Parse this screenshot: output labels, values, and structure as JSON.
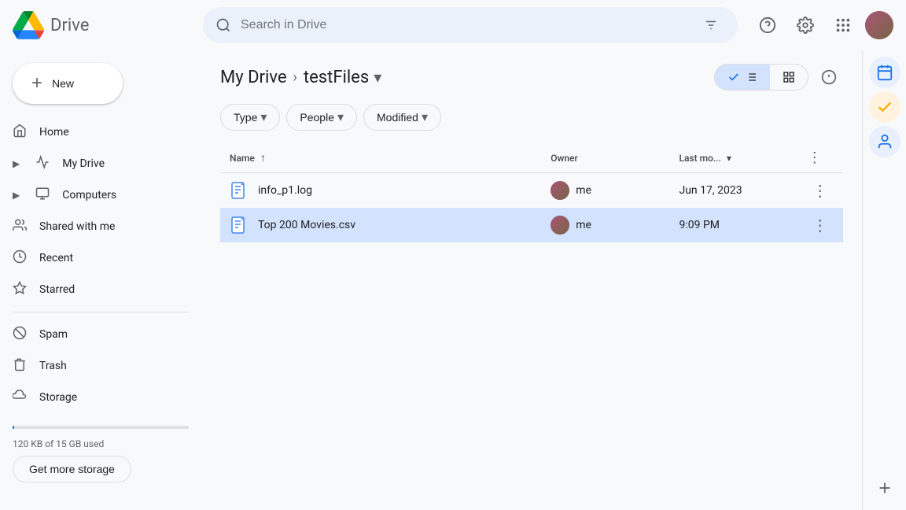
{
  "app": {
    "title": "Drive",
    "logo_alt": "Google Drive"
  },
  "topbar": {
    "search_placeholder": "Search in Drive"
  },
  "sidebar": {
    "new_button": "New",
    "items": [
      {
        "id": "home",
        "label": "Home",
        "icon": "🏠"
      },
      {
        "id": "my-drive",
        "label": "My Drive",
        "icon": "📁",
        "has_arrow": true
      },
      {
        "id": "computers",
        "label": "Computers",
        "icon": "🖥",
        "has_arrow": true
      },
      {
        "id": "shared-with-me",
        "label": "Shared with me",
        "icon": "👤"
      },
      {
        "id": "recent",
        "label": "Recent",
        "icon": "🕐"
      },
      {
        "id": "starred",
        "label": "Starred",
        "icon": "⭐"
      },
      {
        "id": "spam",
        "label": "Spam",
        "icon": "🚫"
      },
      {
        "id": "trash",
        "label": "Trash",
        "icon": "🗑"
      },
      {
        "id": "storage",
        "label": "Storage",
        "icon": "☁"
      }
    ],
    "storage_text": "120 KB of 15 GB used",
    "get_storage_btn": "Get more storage"
  },
  "breadcrumb": {
    "parent": "My Drive",
    "current": "testFiles",
    "separator": "›"
  },
  "view_controls": {
    "list_view_label": "List view",
    "grid_view_label": "Grid view"
  },
  "filters": [
    {
      "id": "type",
      "label": "Type"
    },
    {
      "id": "people",
      "label": "People"
    },
    {
      "id": "modified",
      "label": "Modified"
    }
  ],
  "table": {
    "columns": {
      "name": "Name",
      "owner": "Owner",
      "modified": "Last mo...",
      "sort_indicator": "↑"
    },
    "rows": [
      {
        "id": "file-1",
        "name": "info_p1.log",
        "icon_color": "#4285f4",
        "owner": "me",
        "modified": "Jun 17, 2023",
        "selected": false
      },
      {
        "id": "file-2",
        "name": "Top 200 Movies.csv",
        "icon_color": "#4285f4",
        "owner": "me",
        "modified": "9:09 PM",
        "selected": true
      }
    ]
  },
  "right_sidebar": {
    "icons": [
      {
        "id": "calendar",
        "symbol": "📅",
        "active": true
      },
      {
        "id": "tasks",
        "symbol": "✔",
        "active": false
      },
      {
        "id": "contacts",
        "symbol": "👤",
        "active": false
      }
    ]
  }
}
